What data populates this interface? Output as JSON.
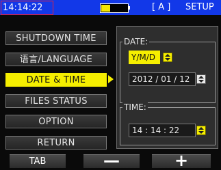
{
  "status_bar": {
    "time": "14:14:22",
    "battery_level": 0.35,
    "mode": "[ A ]",
    "screen_title": "SETUP"
  },
  "menu": {
    "items": [
      {
        "label": "SHUTDOWN TIME"
      },
      {
        "label": "语言/LANGUAGE"
      },
      {
        "label": "DATE & TIME"
      },
      {
        "label": "FILES STATUS"
      },
      {
        "label": "OPTION"
      },
      {
        "label": "RETURN"
      }
    ],
    "selected": "DATE & TIME"
  },
  "date_group": {
    "title": "DATE:",
    "format": "Y/M/D",
    "value": "2012  / 01 / 12"
  },
  "time_group": {
    "title": "TIME:",
    "value": "14  :  14  :  22"
  },
  "softkeys": {
    "tab": "TAB",
    "minus": "—",
    "plus": "+"
  },
  "colors": {
    "topbar": "#1238e8",
    "highlight": "#f5ee00",
    "clock_border": "#e8203a"
  }
}
